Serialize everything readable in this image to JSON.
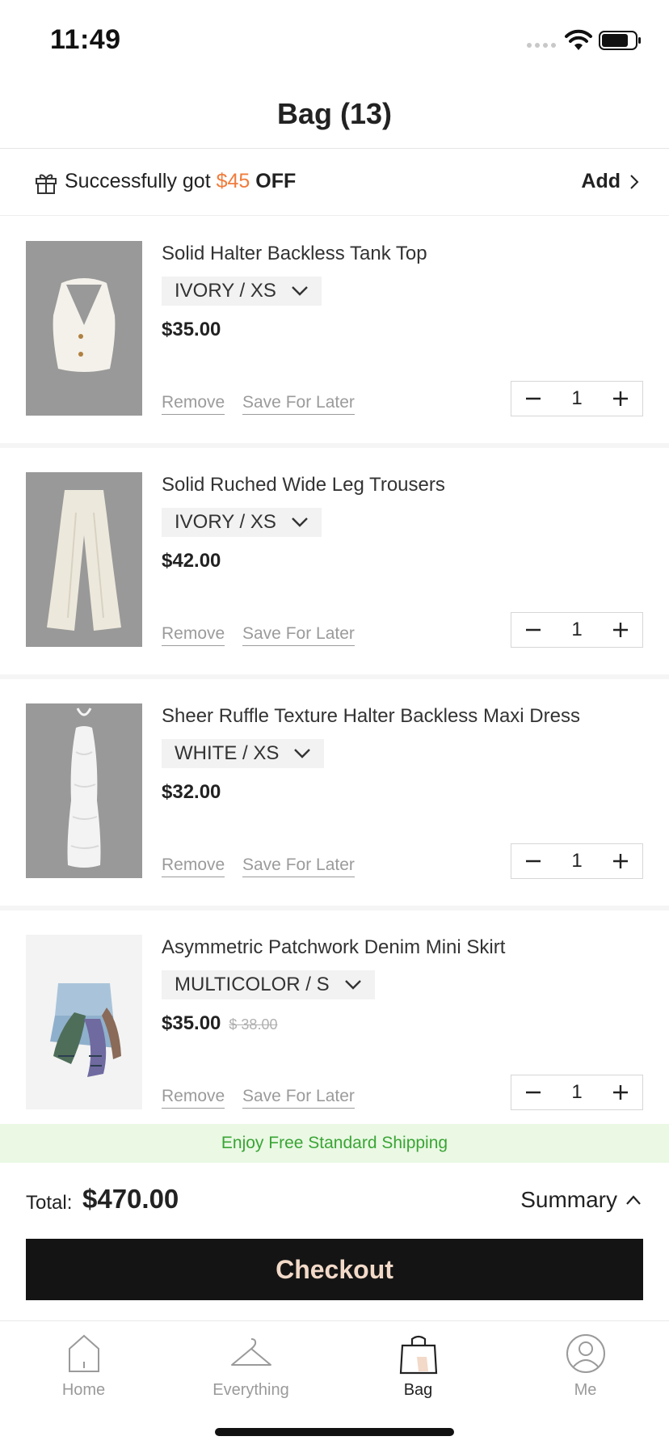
{
  "status_bar": {
    "time": "11:49"
  },
  "header": {
    "title": "Bag (13)"
  },
  "promo": {
    "prefix": "Successfully got ",
    "amount": "$45",
    "suffix": " OFF",
    "action_label": "Add",
    "amount_color": "#f07c3c"
  },
  "items": [
    {
      "title": "Solid Halter Backless Tank Top",
      "variant": "IVORY / XS",
      "price": "$35.00",
      "old_price": "",
      "remove_label": "Remove",
      "save_label": "Save For Later",
      "quantity": "1"
    },
    {
      "title": "Solid Ruched Wide Leg Trousers",
      "variant": "IVORY / XS",
      "price": "$42.00",
      "old_price": "",
      "remove_label": "Remove",
      "save_label": "Save For Later",
      "quantity": "1"
    },
    {
      "title": "Sheer Ruffle Texture Halter Backless Maxi Dress",
      "variant": "WHITE / XS",
      "price": "$32.00",
      "old_price": "",
      "remove_label": "Remove",
      "save_label": "Save For Later",
      "quantity": "1"
    },
    {
      "title": "Asymmetric Patchwork Denim Mini Skirt",
      "variant": "MULTICOLOR / S",
      "price": "$35.00",
      "old_price": "$ 38.00",
      "remove_label": "Remove",
      "save_label": "Save For Later",
      "quantity": "1"
    }
  ],
  "shipping_banner": {
    "text": "Enjoy Free Standard Shipping",
    "color": "#3aa535"
  },
  "footer": {
    "total_label": "Total:",
    "total_value": "$470.00",
    "summary_label": "Summary",
    "checkout_label": "Checkout"
  },
  "tabs": [
    {
      "label": "Home",
      "icon": "home-icon"
    },
    {
      "label": "Everything",
      "icon": "hanger-icon"
    },
    {
      "label": "Bag",
      "icon": "bag-icon",
      "active": true
    },
    {
      "label": "Me",
      "icon": "person-icon"
    }
  ]
}
